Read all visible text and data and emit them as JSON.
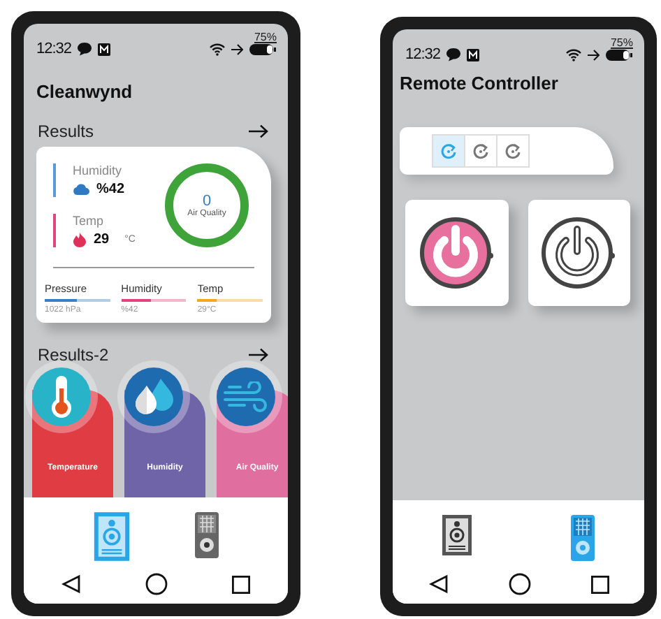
{
  "phones": [
    {
      "kind": "dashboard",
      "status": {
        "time": "12:32",
        "battery": "75%"
      },
      "title": "Cleanwynd",
      "results": {
        "heading": "Results",
        "readings": [
          {
            "kind": "humidity",
            "label": "Humidity",
            "value": "%42",
            "color": "#5b9bd5"
          },
          {
            "kind": "temp",
            "label": "Temp",
            "value": "29",
            "unit": "°C",
            "color": "#e0457b"
          }
        ],
        "air_quality": {
          "value": "0",
          "label": "Air Quality"
        },
        "meters": [
          {
            "label": "Pressure",
            "reading": "1022 hPa",
            "level": 0.5,
            "color": "#3a7fc4"
          },
          {
            "label": "Humidity",
            "reading": "%42",
            "level": 0.45,
            "color": "#e0457b"
          },
          {
            "label": "Temp",
            "reading": "29°C",
            "level": 0.3,
            "color": "#f5a623"
          }
        ]
      },
      "results_2": {
        "heading": "Results-2",
        "cards": [
          {
            "kind": "thermometer",
            "label": "Temperature",
            "color": "#e03c44"
          },
          {
            "kind": "droplets",
            "label": "Humidity",
            "color": "#6f64a8"
          },
          {
            "kind": "wind",
            "label": "Air Quality",
            "color": "#e06fa0"
          }
        ]
      },
      "nav": [
        {
          "kind": "square-remote",
          "selected": true
        },
        {
          "kind": "tall-remote",
          "selected": false
        }
      ]
    },
    {
      "kind": "remote",
      "status": {
        "time": "12:32",
        "battery": "75%"
      },
      "title": "Remote Controller",
      "modes": [
        {
          "selected": true
        },
        {
          "selected": false
        },
        {
          "selected": false
        }
      ],
      "power_buttons": [
        {
          "on": true
        },
        {
          "on": false
        }
      ],
      "nav": [
        {
          "kind": "square-remote",
          "selected": false
        },
        {
          "kind": "tall-remote",
          "selected": true
        }
      ]
    }
  ]
}
